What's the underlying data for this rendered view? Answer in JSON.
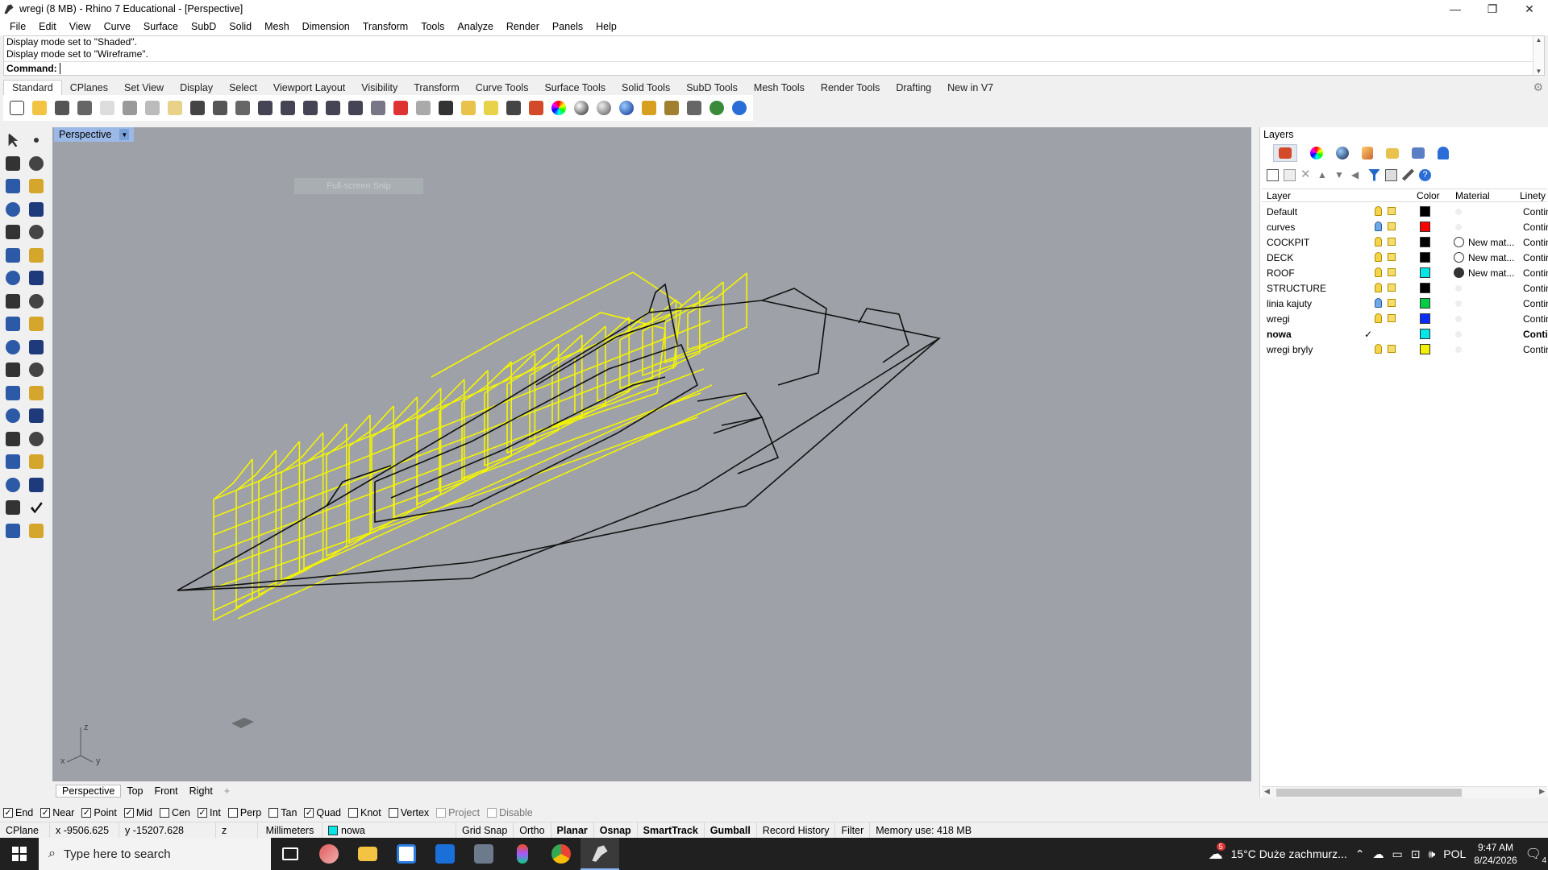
{
  "window": {
    "title": "wregi (8 MB) - Rhino 7 Educational - [Perspective]",
    "minimize": "—",
    "restore": "❐",
    "close": "✕"
  },
  "menu": [
    "File",
    "Edit",
    "View",
    "Curve",
    "Surface",
    "SubD",
    "Solid",
    "Mesh",
    "Dimension",
    "Transform",
    "Tools",
    "Analyze",
    "Render",
    "Panels",
    "Help"
  ],
  "command": {
    "history": [
      "Display mode set to \"Shaded\".",
      "Display mode set to \"Wireframe\"."
    ],
    "prompt": "Command:"
  },
  "toolbar_tabs": [
    "Standard",
    "CPlanes",
    "Set View",
    "Display",
    "Select",
    "Viewport Layout",
    "Visibility",
    "Transform",
    "Curve Tools",
    "Surface Tools",
    "Solid Tools",
    "SubD Tools",
    "Mesh Tools",
    "Render Tools",
    "Drafting",
    "New in V7"
  ],
  "toolbar_icons": [
    "new-file-icon",
    "open-file-icon",
    "save-icon",
    "print-icon",
    "import-icon",
    "cut-icon",
    "copy-icon",
    "paste-icon",
    "undo-icon",
    "pan-hand-icon",
    "move-view-icon",
    "zoom-icon",
    "zoom-window-icon",
    "zoom-extents-icon",
    "zoom-selected-icon",
    "rotate-view-icon",
    "four-viewports-icon",
    "car-render-icon",
    "ghosted-icon",
    "object-snap-icon",
    "point-icon",
    "light-icon",
    "lock-icon",
    "material-icon",
    "color-wheel-icon",
    "sphere-render-icon",
    "sphere-shaded-icon",
    "sphere-blue-icon",
    "filter-icon",
    "gear-settings-icon",
    "options-icon",
    "globe-icon",
    "help-icon"
  ],
  "viewport": {
    "name": "Perspective",
    "snip_hint": "Full-screen Snip",
    "axis_z": "z",
    "axis_y": "y",
    "axis_x": "x"
  },
  "viewport_tabs": [
    "Perspective",
    "Top",
    "Front",
    "Right",
    "+"
  ],
  "osnaps": [
    {
      "label": "End",
      "checked": true
    },
    {
      "label": "Near",
      "checked": true
    },
    {
      "label": "Point",
      "checked": true
    },
    {
      "label": "Mid",
      "checked": true
    },
    {
      "label": "Cen",
      "checked": false
    },
    {
      "label": "Int",
      "checked": true
    },
    {
      "label": "Perp",
      "checked": false
    },
    {
      "label": "Tan",
      "checked": false
    },
    {
      "label": "Quad",
      "checked": true
    },
    {
      "label": "Knot",
      "checked": false
    },
    {
      "label": "Vertex",
      "checked": false
    },
    {
      "label": "Project",
      "checked": false,
      "disabled": true
    },
    {
      "label": "Disable",
      "checked": false,
      "disabled": true
    }
  ],
  "status": {
    "cplane": "CPlane",
    "x": "x -9506.625",
    "y": "y -15207.628",
    "z": "z",
    "units": "Millimeters",
    "layer": "nowa",
    "layer_color": "#00e5e5",
    "grid_snap": "Grid Snap",
    "ortho": "Ortho",
    "planar": "Planar",
    "osnap": "Osnap",
    "smarttrack": "SmartTrack",
    "gumball": "Gumball",
    "record_history": "Record History",
    "filter": "Filter",
    "memory": "Memory use: 418 MB"
  },
  "layers_panel": {
    "title": "Layers",
    "columns": {
      "layer": "Layer",
      "color": "Color",
      "material": "Material",
      "linetype": "Linety"
    },
    "rows": [
      {
        "name": "Default",
        "bulb": "yellow",
        "color": "#000000",
        "material": "",
        "linetype": "Contin"
      },
      {
        "name": "curves",
        "bulb": "blue",
        "color": "#ff0000",
        "material": "",
        "linetype": "Contin"
      },
      {
        "name": "COCKPIT",
        "bulb": "yellow",
        "color": "#000000",
        "material": "New mat...",
        "mat_fill": false,
        "linetype": "Contin"
      },
      {
        "name": "DECK",
        "bulb": "yellow",
        "color": "#000000",
        "material": "New mat...",
        "mat_fill": false,
        "linetype": "Contin"
      },
      {
        "name": "ROOF",
        "bulb": "yellow",
        "color": "#00e5e5",
        "material": "New mat...",
        "mat_fill": true,
        "linetype": "Contin"
      },
      {
        "name": "STRUCTURE",
        "bulb": "yellow",
        "color": "#000000",
        "material": "",
        "linetype": "Contin"
      },
      {
        "name": "linia kajuty",
        "bulb": "blue",
        "color": "#00cc44",
        "material": "",
        "linetype": "Contin"
      },
      {
        "name": "wregi",
        "bulb": "yellow",
        "color": "#0a2cff",
        "material": "",
        "linetype": "Contin"
      },
      {
        "name": "nowa",
        "bulb": "none",
        "current": true,
        "check": "✓",
        "color": "#00e5e5",
        "material": "",
        "linetype": "Contin"
      },
      {
        "name": "wregi bryly",
        "bulb": "yellow",
        "color": "#f0f000",
        "material": "",
        "linetype": "Contin"
      }
    ]
  },
  "taskbar": {
    "search_placeholder": "Type here to search",
    "weather": "15°C  Duże zachmurz...",
    "lang": "POL",
    "time": "9:47 AM",
    "date": "8/24/2026",
    "notif_count": "4",
    "weather_badge": "5"
  }
}
